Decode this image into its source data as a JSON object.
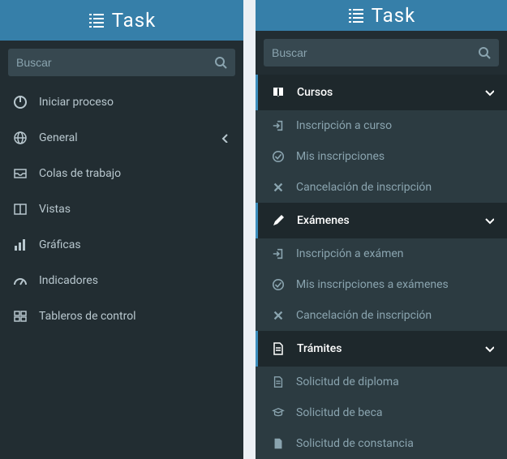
{
  "app": {
    "name": "Task"
  },
  "search": {
    "placeholder": "Buscar"
  },
  "left_menu": [
    {
      "icon": "power",
      "label": "Iniciar proceso"
    },
    {
      "icon": "globe",
      "label": "General",
      "caret": "left"
    },
    {
      "icon": "inbox",
      "label": "Colas de trabajo"
    },
    {
      "icon": "columns",
      "label": "Vistas"
    },
    {
      "icon": "bars",
      "label": "Gráficas"
    },
    {
      "icon": "gauge",
      "label": "Indicadores"
    },
    {
      "icon": "dash",
      "label": "Tableros de control"
    }
  ],
  "right_sections": [
    {
      "icon": "book",
      "label": "Cursos",
      "items": [
        {
          "icon": "signin",
          "label": "Inscripción a curso"
        },
        {
          "icon": "check",
          "label": "Mis inscripciones"
        },
        {
          "icon": "x",
          "label": "Cancelación de inscripción"
        }
      ]
    },
    {
      "icon": "pencil",
      "label": "Exámenes",
      "items": [
        {
          "icon": "signin",
          "label": "Inscripción a exámen"
        },
        {
          "icon": "check",
          "label": "Mis inscripciones a exámenes"
        },
        {
          "icon": "x",
          "label": "Cancelación de inscripción"
        }
      ]
    },
    {
      "icon": "file",
      "label": "Trámites",
      "items": [
        {
          "icon": "file",
          "label": "Solicitud de diploma"
        },
        {
          "icon": "grad",
          "label": "Solicitud de beca"
        },
        {
          "icon": "doc",
          "label": "Solicitud de constancia"
        }
      ]
    }
  ]
}
